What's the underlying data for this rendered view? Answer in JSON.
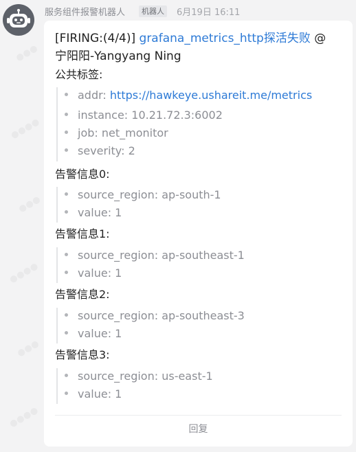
{
  "message": {
    "sender": "服务组件报警机器人",
    "badge": "机器人",
    "time": "6月19日 16:11",
    "title_prefix": "[FIRING:(4/4)]",
    "title_link": "grafana_metrics_http探活失败",
    "title_mention": "@",
    "title_mention_name": "宁阳阳-Yangyang Ning",
    "common_labels_heading": "公共标签:",
    "common_labels": [
      {
        "key": "addr:",
        "value": "https://hawkeye.ushareit.me/metrics"
      },
      {
        "key": "instance:",
        "value": "10.21.72.3:6002"
      },
      {
        "key": "job:",
        "value": "net_monitor"
      },
      {
        "key": "severity:",
        "value": "2"
      }
    ],
    "alerts": [
      {
        "heading": "告警信息0:",
        "source_region": "source_region: ap-south-1",
        "value": "value: 1"
      },
      {
        "heading": "告警信息1:",
        "source_region": "source_region: ap-southeast-1",
        "value": "value: 1"
      },
      {
        "heading": "告警信息2:",
        "source_region": "source_region: ap-southeast-3",
        "value": "value: 1"
      },
      {
        "heading": "告警信息3:",
        "source_region": "source_region: us-east-1",
        "value": "value: 1"
      }
    ],
    "reply_label": "回复"
  },
  "colors": {
    "background": "#f3f3f4",
    "card": "#ffffff",
    "link": "#2d7ad6",
    "muted": "#8c8e94",
    "avatar": "#5d6169"
  },
  "icons": {
    "avatar": "robot-icon",
    "bullet": "bullet-dot-icon"
  }
}
